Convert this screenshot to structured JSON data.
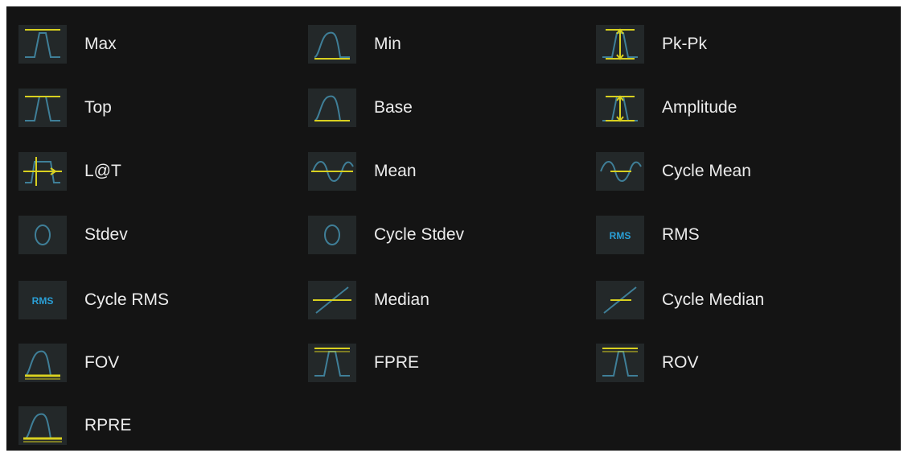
{
  "measurements": [
    {
      "label": "Max",
      "icon": "max-icon"
    },
    {
      "label": "Min",
      "icon": "min-icon"
    },
    {
      "label": "Pk-Pk",
      "icon": "pk-pk-icon"
    },
    {
      "label": "Top",
      "icon": "top-icon"
    },
    {
      "label": "Base",
      "icon": "base-icon"
    },
    {
      "label": "Amplitude",
      "icon": "amplitude-icon"
    },
    {
      "label": "L@T",
      "icon": "level-at-trigger-icon"
    },
    {
      "label": "Mean",
      "icon": "mean-icon"
    },
    {
      "label": "Cycle Mean",
      "icon": "cycle-mean-icon"
    },
    {
      "label": "Stdev",
      "icon": "stdev-icon"
    },
    {
      "label": "Cycle Stdev",
      "icon": "cycle-stdev-icon"
    },
    {
      "label": "RMS",
      "icon": "rms-icon",
      "icon_text": "RMS"
    },
    {
      "label": "Cycle RMS",
      "icon": "cycle-rms-icon",
      "icon_text": "RMS"
    },
    {
      "label": "Median",
      "icon": "median-icon"
    },
    {
      "label": "Cycle Median",
      "icon": "cycle-median-icon"
    },
    {
      "label": "FOV",
      "icon": "fov-icon"
    },
    {
      "label": "FPRE",
      "icon": "fpre-icon"
    },
    {
      "label": "ROV",
      "icon": "rov-icon"
    },
    {
      "label": "RPRE",
      "icon": "rpre-icon"
    }
  ],
  "colors": {
    "background": "#141414",
    "icon_bg": "#232829",
    "waveform": "#3f7f98",
    "marker": "#d8d020",
    "rms_text": "#2a9fd6",
    "label": "#ececec"
  }
}
